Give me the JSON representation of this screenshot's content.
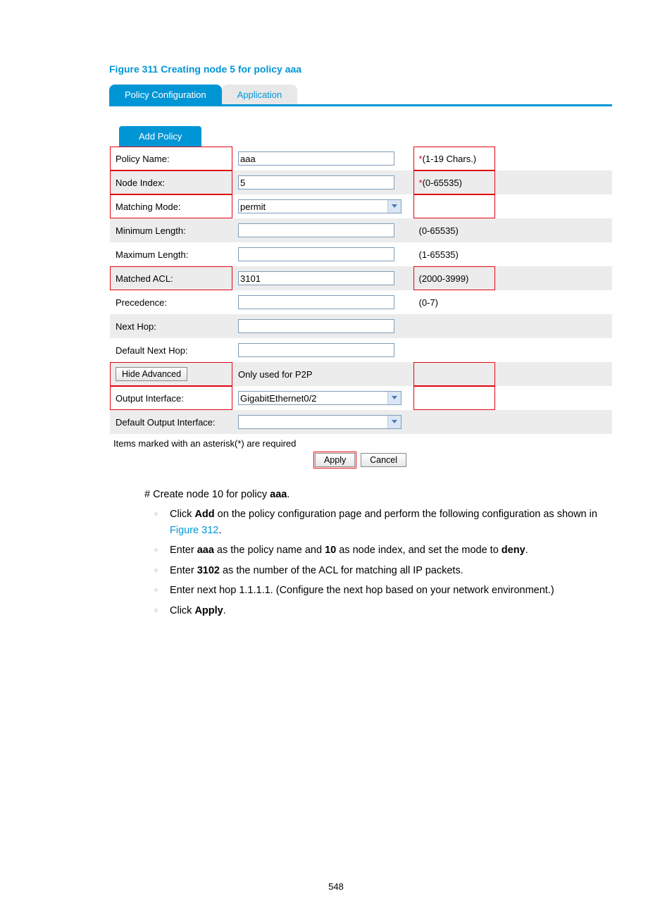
{
  "figure_caption": "Figure 311 Creating node 5 for policy aaa",
  "tabs": {
    "active": "Policy Configuration",
    "inactive": "Application"
  },
  "add_policy_label": "Add Policy",
  "rows": {
    "policy_name": {
      "label": "Policy Name:",
      "value": "aaa",
      "hint_star": "*",
      "hint": "(1-19 Chars.)"
    },
    "node_index": {
      "label": "Node Index:",
      "value": "5",
      "hint_star": "*",
      "hint": "(0-65535)"
    },
    "matching_mode": {
      "label": "Matching Mode:",
      "value": "permit"
    },
    "min_length": {
      "label": "Minimum Length:",
      "value": "",
      "hint": "(0-65535)"
    },
    "max_length": {
      "label": "Maximum Length:",
      "value": "",
      "hint": "(1-65535)"
    },
    "matched_acl": {
      "label": "Matched ACL:",
      "value": "3101",
      "hint": "(2000-3999)"
    },
    "precedence": {
      "label": "Precedence:",
      "value": "",
      "hint": "(0-7)"
    },
    "next_hop": {
      "label": "Next Hop:",
      "value": ""
    },
    "def_next_hop": {
      "label": "Default Next Hop:",
      "value": ""
    },
    "hide_adv": {
      "button": "Hide Advanced",
      "note": "Only used for P2P"
    },
    "out_if": {
      "label": "Output Interface:",
      "value": "GigabitEthernet0/2"
    },
    "def_out_if": {
      "label": "Default Output Interface:",
      "value": ""
    }
  },
  "footer_note": "Items marked with an asterisk(*) are required",
  "buttons": {
    "apply": "Apply",
    "cancel": "Cancel"
  },
  "body": {
    "intro_pre": "# Create node 10 for policy ",
    "intro_bold": "aaa",
    "intro_post": ".",
    "li1_a": "Click ",
    "li1_b": "Add",
    "li1_c": " on the policy configuration page and perform the following configuration as shown in ",
    "li1_link": "Figure 312",
    "li1_d": ".",
    "li2_a": "Enter ",
    "li2_b": "aaa",
    "li2_c": " as the policy name and ",
    "li2_d": "10",
    "li2_e": " as node index, and set the mode to ",
    "li2_f": "deny",
    "li2_g": ".",
    "li3_a": "Enter ",
    "li3_b": "3102",
    "li3_c": " as the number of the ACL for matching all IP packets.",
    "li4": "Enter next hop 1.1.1.1. (Configure the next hop based on your network environment.)",
    "li5_a": "Click ",
    "li5_b": "Apply",
    "li5_c": "."
  },
  "page_number": "548"
}
